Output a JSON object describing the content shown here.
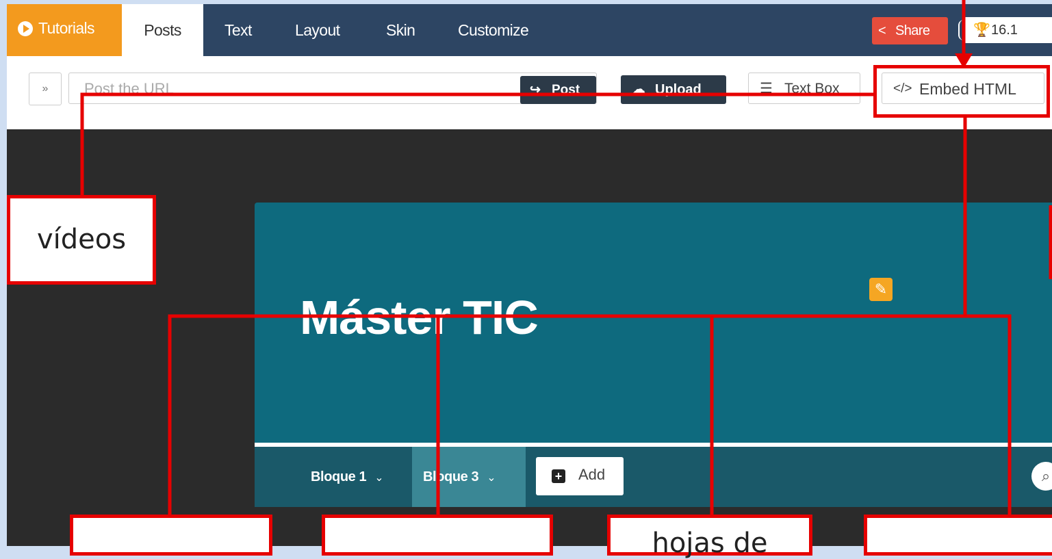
{
  "topbar": {
    "tabs": [
      {
        "label": "Tutorials"
      },
      {
        "label": "Posts"
      },
      {
        "label": "Text"
      },
      {
        "label": "Layout"
      },
      {
        "label": "Skin"
      },
      {
        "label": "Customize"
      }
    ],
    "share_label": "Share",
    "trophy_value": "16.1"
  },
  "toolbar": {
    "url_placeholder": "Post the URL",
    "post_label": "Post",
    "upload_label": "Upload",
    "textbox_label": "Text Box",
    "embed_label": "Embed HTML"
  },
  "board": {
    "title": "Máster TIC",
    "sections": [
      {
        "label": "Bloque 1"
      },
      {
        "label": "Bloque 3"
      }
    ],
    "add_label": "Add"
  },
  "annotations": {
    "videos": "vídeos",
    "hojas": "hojas de"
  },
  "colors": {
    "annotation_red": "#e60000",
    "topbar": "#2d4563",
    "tutorials_tab": "#f39a1e",
    "share": "#e54d3c",
    "board": "#0e6a7e",
    "section_bar": "#1a5969"
  }
}
